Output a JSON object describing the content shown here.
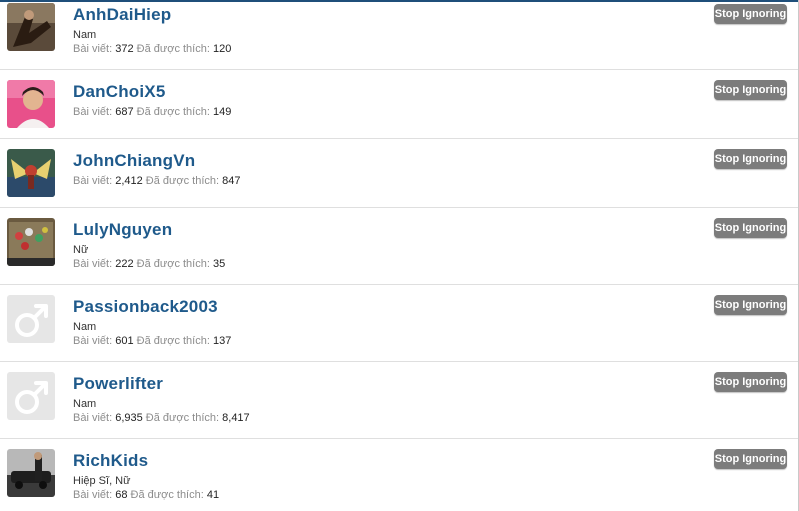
{
  "ignored_users": [
    {
      "username": "AnhDaiHiep",
      "title": "Nam",
      "posts_label": "Bài viết:",
      "posts": "372",
      "likes_label": "Đã được thích:",
      "likes": "120",
      "button_label": "Stop Ignoring",
      "avatar": "photo"
    },
    {
      "username": "DanChoiX5",
      "title": "",
      "posts_label": "Bài viết:",
      "posts": "687",
      "likes_label": "Đã được thích:",
      "likes": "149",
      "button_label": "Stop Ignoring",
      "avatar": "photo"
    },
    {
      "username": "JohnChiangVn",
      "title": "",
      "posts_label": "Bài viết:",
      "posts": "2,412",
      "likes_label": "Đã được thích:",
      "likes": "847",
      "button_label": "Stop Ignoring",
      "avatar": "photo"
    },
    {
      "username": "LulyNguyen",
      "title": "Nữ",
      "posts_label": "Bài viết:",
      "posts": "222",
      "likes_label": "Đã được thích:",
      "likes": "35",
      "button_label": "Stop Ignoring",
      "avatar": "photo"
    },
    {
      "username": "Passionback2003",
      "title": "Nam",
      "posts_label": "Bài viết:",
      "posts": "601",
      "likes_label": "Đã được thích:",
      "likes": "137",
      "button_label": "Stop Ignoring",
      "avatar": "male-default-icon"
    },
    {
      "username": "Powerlifter",
      "title": "Nam",
      "posts_label": "Bài viết:",
      "posts": "6,935",
      "likes_label": "Đã được thích:",
      "likes": "8,417",
      "button_label": "Stop Ignoring",
      "avatar": "male-default-icon"
    },
    {
      "username": "RichKids",
      "title": "Hiệp Sĩ, Nữ",
      "posts_label": "Bài viết:",
      "posts": "68",
      "likes_label": "Đã được thích:",
      "likes": "41",
      "button_label": "Stop Ignoring",
      "avatar": "photo"
    }
  ],
  "colors": {
    "username": "#1f5a8b",
    "button": "#7c7c7c",
    "divider": "#dfdfdf"
  }
}
